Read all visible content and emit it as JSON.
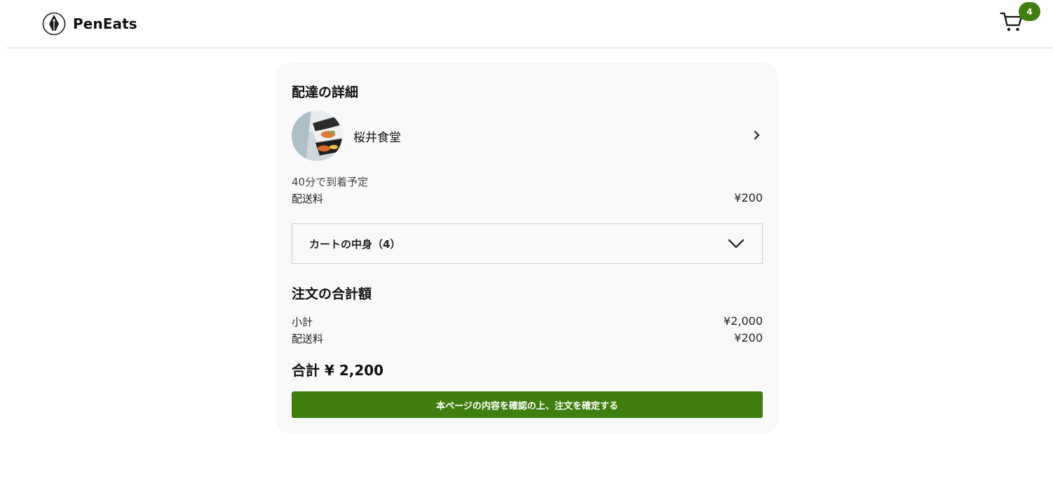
{
  "header": {
    "brand": "PenEats",
    "cart_count": "4"
  },
  "delivery": {
    "title": "配達の詳細",
    "restaurant_name": "桜井食堂",
    "eta": "40分で到着予定",
    "fee_label": "配送料",
    "fee_value": "¥200"
  },
  "cart": {
    "toggle_label": "カートの中身（4）"
  },
  "summary": {
    "title": "注文の合計額",
    "subtotal_label": "小計",
    "subtotal_value": "¥2,000",
    "fee_label": "配送料",
    "fee_value": "¥200",
    "total": "合計 ¥ 2,200"
  },
  "confirm_button": "本ページの内容を確認の上、注文を確定する",
  "colors": {
    "accent": "#3f7f0f",
    "card_bg": "#f9f9f9",
    "divider": "#dddddd"
  },
  "icons": {
    "logo": "fountain-pen-nib-icon",
    "cart": "shopping-cart-icon",
    "restaurant_row": "chevron-right-icon",
    "cart_toggle": "chevron-down-icon"
  }
}
